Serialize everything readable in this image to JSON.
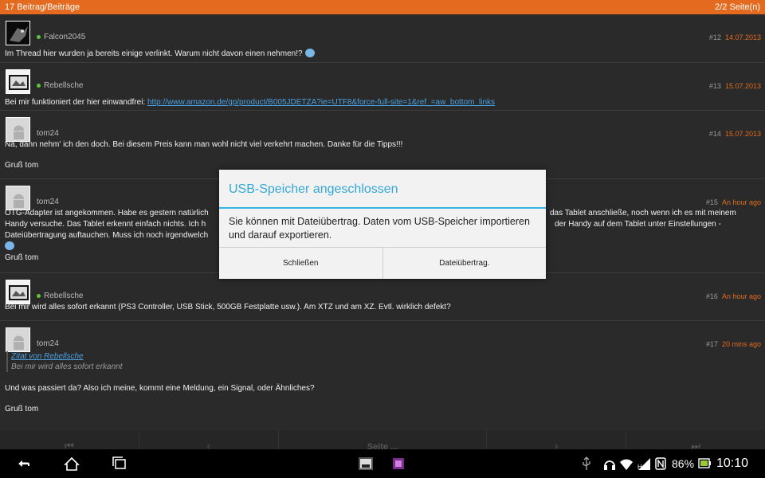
{
  "topbar": {
    "left": "17 Beitrag/Beiträge",
    "right": "2/2 Seite(n)"
  },
  "posts": [
    {
      "author": "Falcon2045",
      "num": "#12",
      "date": "14.07.2013",
      "text": "Im Thread hier wurden ja bereits einige verlinkt. Warum nicht davon einen nehmen!?"
    },
    {
      "author": "Rebellsche",
      "num": "#13",
      "date": "15.07.2013",
      "text_prefix": "Bei mir funktioniert der hier einwandfrei: ",
      "link": "http://www.amazon.de/gp/product/B005JDETZA?ie=UTF8&force-full-site=1&ref_=aw_bottom_links"
    },
    {
      "author": "tom24",
      "num": "#14",
      "date": "15.07.2013",
      "text": "Na, dann nehm' ich den doch. Bei diesem Preis kann man wohl nicht viel verkehrt machen. Danke für die Tipps!!!",
      "sign": "Gruß tom"
    },
    {
      "author": "tom24",
      "num": "#15",
      "date": "An hour ago",
      "text_l1": "OTG-Adapter ist angekommen. Habe es gestern natürlich",
      "text_r1": "das Tablet anschließe, noch wenn ich es mit meinem",
      "text_l2": "Handy versuche. Das Tablet erkennt einfach nichts. Ich h",
      "text_r2": "der Handy auf dem Tablet unter Einstellungen -",
      "text_l3": "Dateiübertragung auftauchen. Muss ich noch irgendwelch",
      "sign": "Gruß tom"
    },
    {
      "author": "Rebellsche",
      "num": "#16",
      "date": "An hour ago",
      "text": "Bei mir wird alles sofort erkannt (PS3 Controller, USB Stick, 500GB Festplatte usw.). Am XTZ und am XZ. Evtl. wirklich defekt?"
    },
    {
      "author": "tom24",
      "num": "#17",
      "date": "20 mins ago",
      "quote_author": "Zitat von Rebellsche",
      "quote_text": "Bei mir wird alles sofort erkannt",
      "text": "Und was passiert da? Also ich meine, kommt eine Meldung, ein Signal, oder Ähnliches?",
      "sign": "Gruß tom"
    }
  ],
  "pager": {
    "page_label": "Seite ..."
  },
  "dialog": {
    "title": "USB-Speicher angeschlossen",
    "message": "Sie können mit Dateiübertrag. Daten vom USB-Speicher importieren und darauf exportieren.",
    "close_label": "Schließen",
    "transfer_label": "Dateiübertrag."
  },
  "status": {
    "battery": "86%",
    "time": "10:10"
  }
}
